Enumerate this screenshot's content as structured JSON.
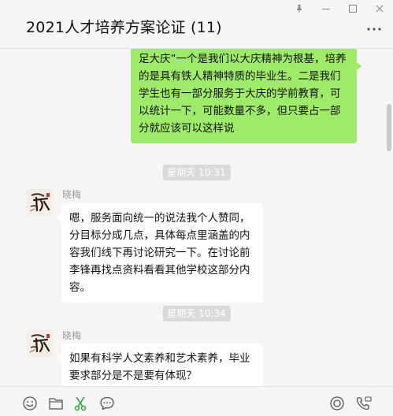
{
  "window": {
    "title": "2021人才培养方案论证 (11)"
  },
  "messages": {
    "outgoing_1": "足大庆”一个是我们以大庆精神为根基，培养的是具有铁人精神特质的毕业生。二是我们学生也有一部分服务于大庆的学前教育，可以统计一下，可能数量不多，但只要占一部分就应该可以这样说",
    "timestamp_1": "星期天 10:31",
    "sender_1": "晓梅",
    "incoming_1": "嗯，服务面向统一的说法我个人赞同，分目标分成几点，具体每点里涵盖的内容我们线下再讨论研究一下。在讨论前李锋再找点资料看看其他学校这部分内容。",
    "timestamp_2": "星期天 10:34",
    "sender_2": "晓梅",
    "incoming_2": "如果有科学人文素养和艺术素养，毕业要求部分是不是要有体现？"
  },
  "icons": [
    "pin-icon",
    "minimize-icon",
    "maximize-icon",
    "close-icon",
    "more-icon",
    "emoji-icon",
    "folder-icon",
    "scissors-icon",
    "chat-history-icon",
    "live-icon",
    "voice-call-icon"
  ],
  "colors": {
    "outgoing_bubble": "#9eea6a",
    "incoming_bubble": "#ffffff",
    "background": "#f5f5f5",
    "timestamp_bg": "#dadada"
  }
}
